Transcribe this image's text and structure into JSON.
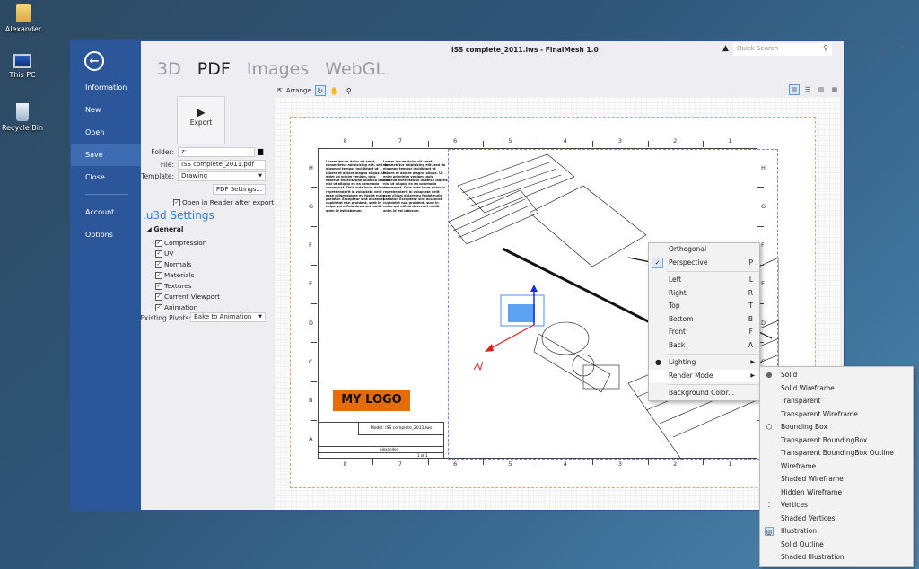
{
  "desktop": {
    "icons": [
      {
        "label": "Alexander",
        "icon": "user-folder-icon"
      },
      {
        "label": "This PC",
        "icon": "computer-icon"
      },
      {
        "label": "Recycle Bin",
        "icon": "recycle-bin-icon"
      }
    ]
  },
  "window": {
    "title": "ISS complete_2011.lws - FinalMesh 1.0",
    "quick_search_placeholder": "Quick Search",
    "controls": {
      "help": "?",
      "minimize": "—",
      "restore": "▫",
      "close": "✕"
    }
  },
  "backstage": {
    "back_icon": "back-arrow-icon",
    "items": [
      {
        "label": "Information",
        "active": false
      },
      {
        "label": "New",
        "active": false
      },
      {
        "label": "Open",
        "active": false
      },
      {
        "label": "Save",
        "active": true
      },
      {
        "label": "Close",
        "active": false
      },
      {
        "label": "Account",
        "active": false
      },
      {
        "label": "Options",
        "active": false
      }
    ]
  },
  "mode_tabs": [
    {
      "label": "3D",
      "active": false
    },
    {
      "label": "PDF",
      "active": true
    },
    {
      "label": "Images",
      "active": false
    },
    {
      "label": "WebGL",
      "active": false
    }
  ],
  "toolbar": {
    "arrange_label": "Arrange",
    "tools": [
      "rotate-icon",
      "pan-hand-icon",
      "zoom-icon"
    ]
  },
  "view_layouts": [
    "single-view-icon",
    "horizontal-split-icon",
    "vertical-split-icon",
    "quad-view-icon"
  ],
  "export": {
    "button_label": "Export",
    "folder_label": "Folder:",
    "folder_value": "z:",
    "file_label": "File:",
    "file_value": "ISS complete_2011.pdf",
    "template_label": "Template:",
    "template_value": "Drawing",
    "pdf_settings_label": "PDF Settings...",
    "open_in_reader_label": "Open in Reader after export",
    "open_in_reader_checked": true
  },
  "u3d": {
    "title": ".u3d Settings",
    "group": "General",
    "options": [
      {
        "label": "Compression",
        "checked": true
      },
      {
        "label": "UV",
        "checked": true
      },
      {
        "label": "Normals",
        "checked": true
      },
      {
        "label": "Materials",
        "checked": true
      },
      {
        "label": "Textures",
        "checked": true
      },
      {
        "label": "Current Viewport",
        "checked": true
      },
      {
        "label": "Animation",
        "checked": true
      }
    ],
    "existing_pivots_label": "Existing Pivots:",
    "existing_pivots_value": "Bake to Animation"
  },
  "drawing": {
    "columns": [
      "8",
      "7",
      "6",
      "5",
      "4",
      "3",
      "2",
      "1"
    ],
    "rows": [
      "H",
      "G",
      "F",
      "E",
      "D",
      "C",
      "B",
      "A"
    ],
    "lorem": "Lorem ipsum dolor sit amet, consectetur adipisicing elit, sed do eiusmod tempor incididunt ut labore et dolore magna aliqua. Ut enim ad minim veniam, quis nostrud exercitation ullamco laboris nisi ut aliquip ex ea commodo consequat. Duis aute irure dolor in reprehenderit in voluptate velit esse cillum dolore eu fugiat nulla pariatur. Excepteur sint occaecat cupidatat non proident, sunt in culpa qui officia deserunt mollit anim id est laborum.",
    "logo_text": "MY LOGO",
    "title_block": {
      "model": "Model: ISS complete_2011.lws",
      "author": "Alexander",
      "sheet": "1 of 1"
    }
  },
  "context_menu": {
    "items": [
      {
        "label": "Orthogonal",
        "key": "",
        "checked": false
      },
      {
        "label": "Perspective",
        "key": "P",
        "checked": true
      },
      {
        "sep": true
      },
      {
        "label": "Left",
        "key": "L"
      },
      {
        "label": "Right",
        "key": "R"
      },
      {
        "label": "Top",
        "key": "T"
      },
      {
        "label": "Bottom",
        "key": "B"
      },
      {
        "label": "Front",
        "key": "F"
      },
      {
        "label": "Back",
        "key": "A"
      },
      {
        "sep": true
      },
      {
        "label": "Lighting",
        "submenu": true,
        "icon": "bulb-icon"
      },
      {
        "label": "Render Mode",
        "submenu": true,
        "highlighted": true
      },
      {
        "sep": true
      },
      {
        "label": "Background Color..."
      }
    ]
  },
  "render_mode_menu": {
    "items": [
      {
        "label": "Solid",
        "icon": "sphere-icon"
      },
      {
        "label": "Solid Wireframe"
      },
      {
        "label": "Transparent"
      },
      {
        "label": "Transparent Wireframe"
      },
      {
        "label": "Bounding Box",
        "icon": "bounding-box-icon"
      },
      {
        "label": "Transparent BoundingBox"
      },
      {
        "label": "Transparent BoundingBox Outline"
      },
      {
        "label": "Wireframe"
      },
      {
        "label": "Shaded Wireframe"
      },
      {
        "label": "Hidden Wireframe"
      },
      {
        "label": "Vertices",
        "icon": "vertices-icon"
      },
      {
        "label": "Shaded Vertices"
      },
      {
        "label": "Illustration",
        "icon": "illustration-icon",
        "selected": true
      },
      {
        "label": "Solid Outline"
      },
      {
        "label": "Shaded Illustration"
      }
    ]
  }
}
